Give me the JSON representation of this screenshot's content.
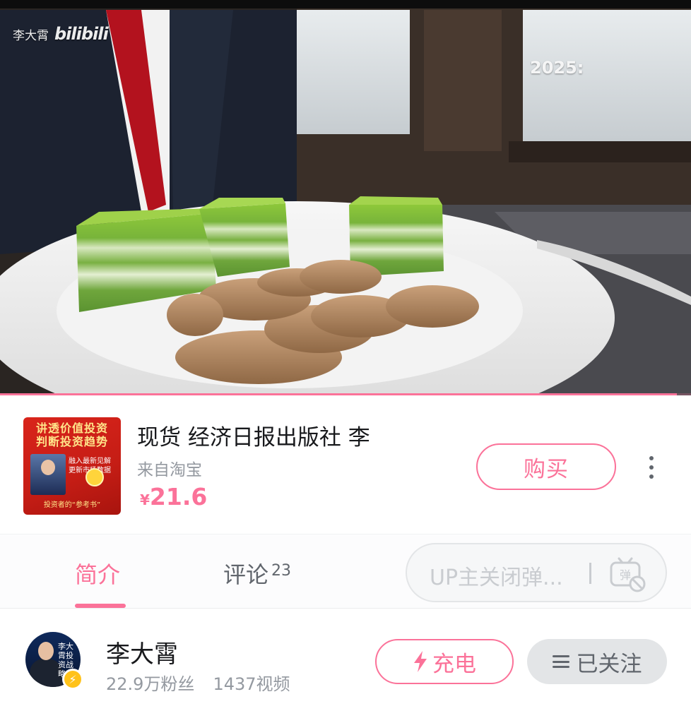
{
  "video": {
    "watermark_author": "李大霄",
    "watermark_logo": "bilibili",
    "timestamp": "2025:",
    "progress": 0.98,
    "accent_color": "#fb7299"
  },
  "product": {
    "cover_lines": [
      "讲透价值投资",
      "判断投资趋势"
    ],
    "cover_side_text": "融入最新见解 更新市场数据",
    "cover_footer": "投资者的“参考书”",
    "title": "现货 经济日报出版社 李",
    "source": "来自淘宝",
    "currency": "¥",
    "price": "21.6",
    "buy_label": "购买",
    "more_icon": "more-vertical-icon"
  },
  "tabs": {
    "intro_label": "简介",
    "comments_label": "评论",
    "comments_count": "23",
    "danmaku_placeholder": "UP主关闭弹...",
    "danmaku_icon": "danmaku-off-icon"
  },
  "uploader": {
    "avatar_text": "李大霄投资战略",
    "name": "李大霄",
    "fans": "22.9万粉丝",
    "videos": "1437视频",
    "charge_label": "充电",
    "follow_label": "已关注",
    "badge_icon": "lightning-icon"
  }
}
